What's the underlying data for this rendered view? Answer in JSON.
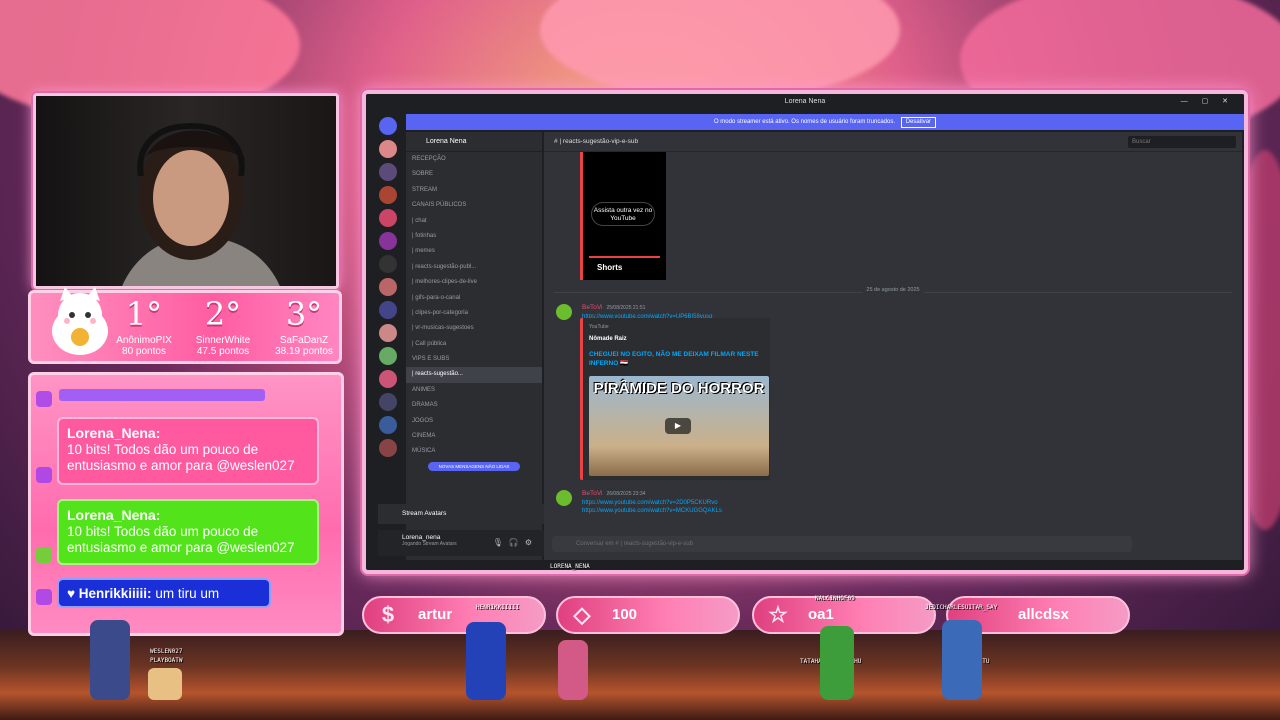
{
  "webcam": {
    "label": "streamer webcam"
  },
  "ranking": [
    {
      "pos": "1°",
      "name": "AnônimoPIX",
      "points": "80 pontos"
    },
    {
      "pos": "2°",
      "name": "SinnerWhite",
      "points": "47.5 pontos"
    },
    {
      "pos": "3°",
      "name": "SaFaDanZ",
      "points": "38.19 pontos"
    }
  ],
  "chat": {
    "messages": [
      {
        "user": "Lorena_Nena:",
        "text": "10 bits! Todos dão um pouco de entusiasmo e amor para @weslen027"
      },
      {
        "user": "Lorena_Nena:",
        "text": "10 bits! Todos dão um pouco de entusiasmo e amor para @weslen027"
      },
      {
        "user": "Henrikkiiiii:",
        "text": "um tiru um"
      }
    ]
  },
  "discord": {
    "window_title": "Lorena Nena",
    "banner_text": "O modo streamer está ativo. Os nomes de usuário foram truncados.",
    "banner_button": "Desativar",
    "server_name": "Lorena Nena",
    "channel_header": "| reacts-sugestão-vip-e-sub",
    "search_placeholder": "Buscar",
    "channels": [
      "RECEPÇÃO",
      "SOBRE",
      "STREAM",
      "CANAIS PÚBLICOS",
      "| chat",
      "| fotinhas",
      "| memes",
      "| reacts-sugestão-publ...",
      "| melhores-clipes-de-live",
      "| gifs-para-o-canal",
      "| clipes-por-categoria",
      "| vr-musicas-sugestoes",
      "| Call pública",
      "VIPS E SUBS",
      "| reacts-sugestão...",
      "ANIMES",
      "DRAMAS",
      "JOGOS",
      "CINEMA",
      "MÚSICA"
    ],
    "new_messages_pill": "NOVAS MENSAGENS NÃO LIDAS",
    "stream_avatars": "Stream Avatars",
    "user_name": "Lorena_nena",
    "user_status": "Jogando Stream Avatars",
    "shorts_replay": "Assista outra vez no YouTube",
    "shorts_label": "Shorts",
    "date_separator": "25 de agosto de 2025",
    "posts": [
      {
        "author": "BeToVi",
        "time": "25/08/2025 21:51",
        "link": "https://www.youtube.com/watch?v=UP6B|58yusg"
      },
      {
        "author": "BeToVi",
        "time": "26/08/2025 23:34",
        "link": "https://www.youtube.com/watch?v=2D0P5CKURvo",
        "link2": "https://www.youtube.com/watch?v=MCKUGGQAKLs"
      }
    ],
    "embed": {
      "source": "YouTube",
      "author": "Nômade Raiz",
      "title": "CHEGUEI NO EGITO, NÃO ME DEIXAM FILMAR NESTE INFERNO 🇪🇬",
      "thumb_text": "PIRÂMIDE DO HORROR"
    },
    "composer_placeholder": "Conversar em # | reacts-sugestão-vip-e-sub"
  },
  "stream_label": "LORENA_NENA",
  "bottom_bar": [
    {
      "icon": "dollar-icon",
      "text": "artur"
    },
    {
      "icon": "diamond-icon",
      "text": "100"
    },
    {
      "icon": "star-icon",
      "text": "oa1"
    },
    {
      "icon": "none",
      "text": "allcdsx"
    }
  ],
  "sprites": [
    "WESLEN027",
    "PLAYBOATW",
    "HENRIKKIIIII",
    "NALCINHOF09",
    "TATAHABBRAPIKACHU",
    "JEDICHARLESUITAR_SAY",
    "SWSLEYTTU"
  ]
}
